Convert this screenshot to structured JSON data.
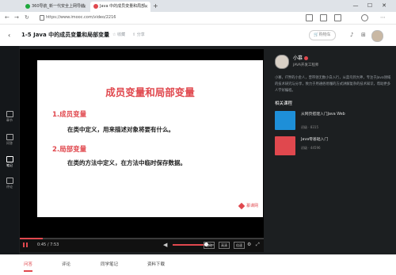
{
  "browser": {
    "tabs": [
      {
        "label": "360导航_新一代安全上网导航",
        "color": "#1ea83c"
      },
      {
        "label": "Java 中的成员变量和局部",
        "color": "#e0484e"
      }
    ],
    "url": "https://www.imooc.com/video/2216",
    "window_controls": {
      "minimize": "—",
      "maximize": "☐",
      "close": "✕"
    }
  },
  "header": {
    "title": "1-5 Java 中的成员变量和局部变量",
    "collect": "收藏",
    "share": "分享",
    "buy_label": "购物车",
    "icons": [
      "bell-icon",
      "grid-icon"
    ]
  },
  "left_sidebar": [
    {
      "label": "章节",
      "icon": "chapter-icon"
    },
    {
      "label": "问答",
      "icon": "qa-icon"
    },
    {
      "label": "笔记",
      "icon": "note-icon",
      "active": true
    },
    {
      "label": "评论",
      "icon": "comment-icon"
    }
  ],
  "slide": {
    "title": "成员变量和局部变量",
    "section1_heading": "1.成员变量",
    "section1_text": "在类中定义，用来描述对象将要有什么。",
    "section2_heading": "2.局部变量",
    "section2_text": "在类的方法中定义，在方法中临时保存数据。",
    "watermark": "慕课网"
  },
  "player": {
    "time": "0:45 / 7:53",
    "progress": 0.095,
    "volume": 0.8,
    "buttons": [
      "自动",
      "高清",
      "倍速"
    ],
    "icons": [
      "settings-icon",
      "fullscreen-icon"
    ]
  },
  "teacher": {
    "name": "小慕",
    "title": "JAVA开发工程师",
    "description": "小慕，IT界的小金人，曾带领无数小白入行，从菜鸟到大神，专注于Java领域的技术研究与分享，致力于用通俗易懂的方式讲解复杂的技术知识，帮助更多人学好编程。"
  },
  "related": {
    "heading": "相关课程",
    "courses": [
      {
        "name": "从网页搭建入门Java Web",
        "level": "初级",
        "count": "8315",
        "color": "#1e8fd8"
      },
      {
        "name": "Java零基础入门",
        "level": "初级",
        "count": "44596",
        "color": "#e0484e"
      }
    ]
  },
  "bottom_tabs": [
    {
      "label": "问答",
      "active": true
    },
    {
      "label": "评论"
    },
    {
      "label": "同学笔记"
    },
    {
      "label": "资料下载"
    }
  ]
}
